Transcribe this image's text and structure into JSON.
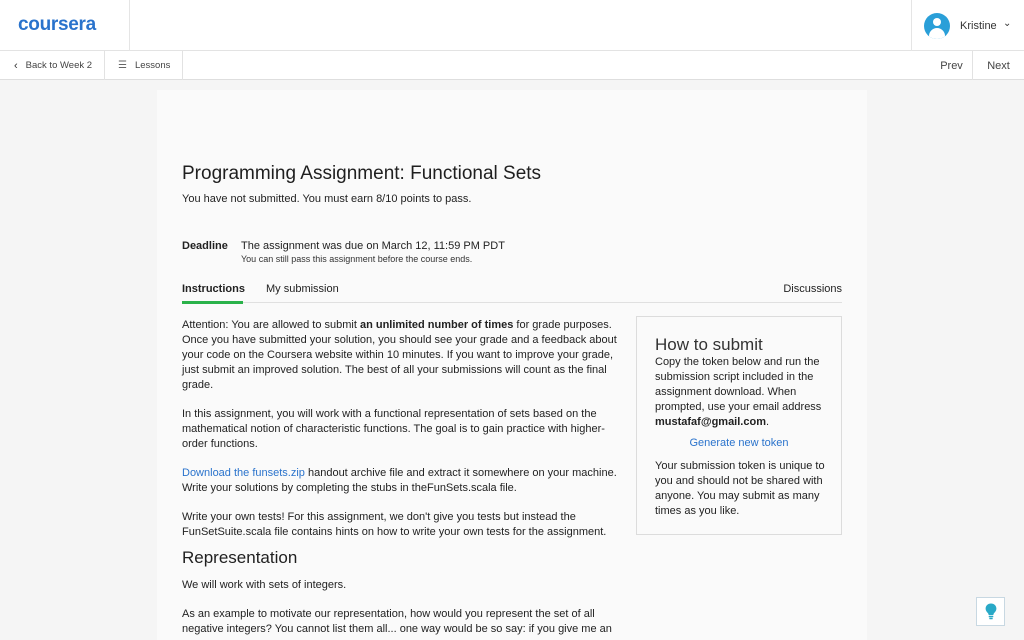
{
  "header": {
    "logo": "coursera",
    "user_name": "Kristine",
    "user_chevron": "⌄"
  },
  "subnav": {
    "back_label": "Back to Week 2",
    "lessons_label": "Lessons",
    "prev_label": "Prev",
    "next_label": "Next"
  },
  "assignment": {
    "title": "Programming Assignment: Functional Sets",
    "status": "You have not submitted. You must earn 8/10 points to pass.",
    "deadline_label": "Deadline",
    "deadline_text": "The assignment was due on March 12, 11:59 PM PDT",
    "deadline_note": "You can still pass this assignment before the course ends."
  },
  "tabs": {
    "instructions": "Instructions",
    "my_submission": "My submission",
    "discussions": "Discussions"
  },
  "instructions": {
    "p1_before": "Attention: You are allowed to submit ",
    "p1_bold": "an unlimited number of times",
    "p1_after": " for grade purposes. Once you have submitted your solution, you should see your grade and a feedback about your code on the Coursera website within 10 minutes. If you want to improve your grade, just submit an improved solution. The best of all your submissions will count as the final grade.",
    "p2": "In this assignment, you will work with a functional representation of sets based on the mathematical notion of characteristic functions. The goal is to gain practice with higher-order functions.",
    "p3_link": "Download the funsets.zip",
    "p3_after": " handout archive file and extract it somewhere on your machine. Write your solutions by completing the stubs in theFunSets.scala file.",
    "p4": "Write your own tests! For this assignment, we don't give you tests but instead the FunSetSuite.scala file contains hints on how to write your own tests for the assignment.",
    "section_heading": "Representation",
    "p5": "We will work with sets of integers.",
    "p6": "As an example to motivate our representation, how would you represent the set of all negative integers? You cannot list them all... one way would be so say: if you give me an"
  },
  "howto": {
    "title": "How to submit",
    "text": "Copy the token below and run the submission script included in the assignment download. When prompted, use your email address ",
    "email": "mustafaf@gmail.com",
    "period": ".",
    "generate_link": "Generate new token",
    "text2": "Your submission token is unique to you and should not be shared with anyone. You may submit as many times as you like."
  },
  "colors": {
    "brand": "#2a73cc",
    "tab_active": "#2ab24a",
    "avatar": "#2a9fd8",
    "bulb": "#29a9c7"
  },
  "icons": {
    "back": "chevron-left-icon",
    "lessons": "list-icon",
    "user_menu": "chevron-down-icon",
    "help": "lightbulb-icon"
  }
}
